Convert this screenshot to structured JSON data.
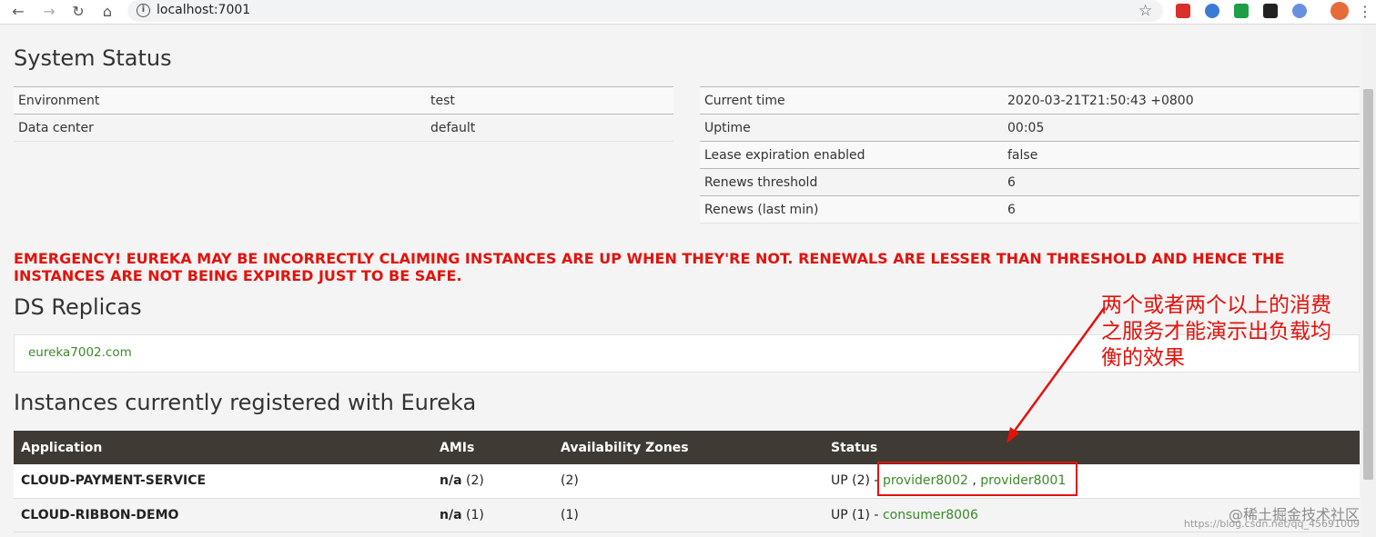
{
  "browser": {
    "url": "localhost:7001"
  },
  "page": {
    "system_status_title": "System Status",
    "left_table": [
      {
        "label": "Environment",
        "value": "test"
      },
      {
        "label": "Data center",
        "value": "default"
      }
    ],
    "right_table": [
      {
        "label": "Current time",
        "value": "2020-03-21T21:50:43 +0800"
      },
      {
        "label": "Uptime",
        "value": "00:05"
      },
      {
        "label": "Lease expiration enabled",
        "value": "false"
      },
      {
        "label": "Renews threshold",
        "value": "6"
      },
      {
        "label": "Renews (last min)",
        "value": "6"
      }
    ],
    "emergency_text": "EMERGENCY! EUREKA MAY BE INCORRECTLY CLAIMING INSTANCES ARE UP WHEN THEY'RE NOT. RENEWALS ARE LESSER THAN THRESHOLD AND HENCE THE INSTANCES ARE NOT BEING EXPIRED JUST TO BE SAFE.",
    "ds_replicas_title": "DS Replicas",
    "replica": "eureka7002.com",
    "instances_title": "Instances currently registered with Eureka",
    "instances_headers": [
      "Application",
      "AMIs",
      "Availability Zones",
      "Status"
    ],
    "instances": [
      {
        "app": "CLOUD-PAYMENT-SERVICE",
        "amis_bold": "n/a",
        "amis_count": "(2)",
        "zones": "(2)",
        "status_prefix": "UP (2) - ",
        "link1": "provider8002",
        "sep": " , ",
        "link2": "provider8001"
      },
      {
        "app": "CLOUD-RIBBON-DEMO",
        "amis_bold": "n/a",
        "amis_count": "(1)",
        "zones": "(1)",
        "status_prefix": "UP (1) - ",
        "link1": "consumer8006",
        "sep": "",
        "link2": ""
      }
    ]
  },
  "annotation": {
    "line1": "两个或者两个以上的消费",
    "line2": "之服务才能演示出负载均",
    "line3": "衡的效果",
    "color": "#e3120b"
  },
  "watermark": {
    "main": "@稀土掘金技术社区",
    "small": "https://blog.csdn.net/qq_45691009"
  }
}
